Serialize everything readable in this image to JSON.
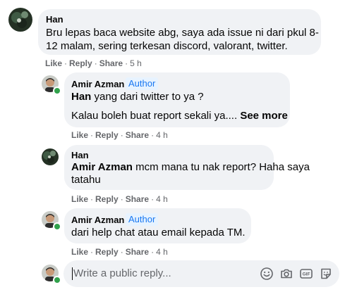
{
  "comments": [
    {
      "author": "Han",
      "lines": [
        "Bru lepas baca website abg, saya ada issue ni dari pkul 8-",
        "12 malam, sering terkesan discord, valorant, twitter."
      ],
      "actions": {
        "like": "Like",
        "reply": "Reply",
        "share": "Share",
        "time": "5 h"
      }
    },
    {
      "author": "Amir Azman",
      "badge": "Author",
      "line1_mention": "Han",
      "line1_text": " yang dari twitter to ya ?",
      "line2_text": "Kalau boleh buat report sekali ya....",
      "see_more": "See more",
      "actions": {
        "like": "Like",
        "reply": "Reply",
        "share": "Share",
        "time": "4 h"
      }
    },
    {
      "author": "Han",
      "line1_mention": "Amir Azman",
      "line1_text": " mcm mana tu nak report? Haha saya",
      "line2_text": "tatahu",
      "actions": {
        "like": "Like",
        "reply": "Reply",
        "share": "Share",
        "time": "4 h"
      }
    },
    {
      "author": "Amir Azman",
      "badge": "Author",
      "line1_text": "dari help chat atau email kepada TM.",
      "actions": {
        "like": "Like",
        "reply": "Reply",
        "share": "Share",
        "time": "4 h"
      }
    }
  ],
  "reply_box": {
    "placeholder": "Write a public reply..."
  },
  "reply_icons": [
    "smiley-icon",
    "camera-icon",
    "gif-icon",
    "sticker-icon"
  ],
  "colors": {
    "bubble": "#f0f2f5",
    "secondary_text": "#65676b",
    "author_badge_bg": "#e7f3ff",
    "author_badge_text": "#1877f2",
    "online": "#31a24c"
  }
}
